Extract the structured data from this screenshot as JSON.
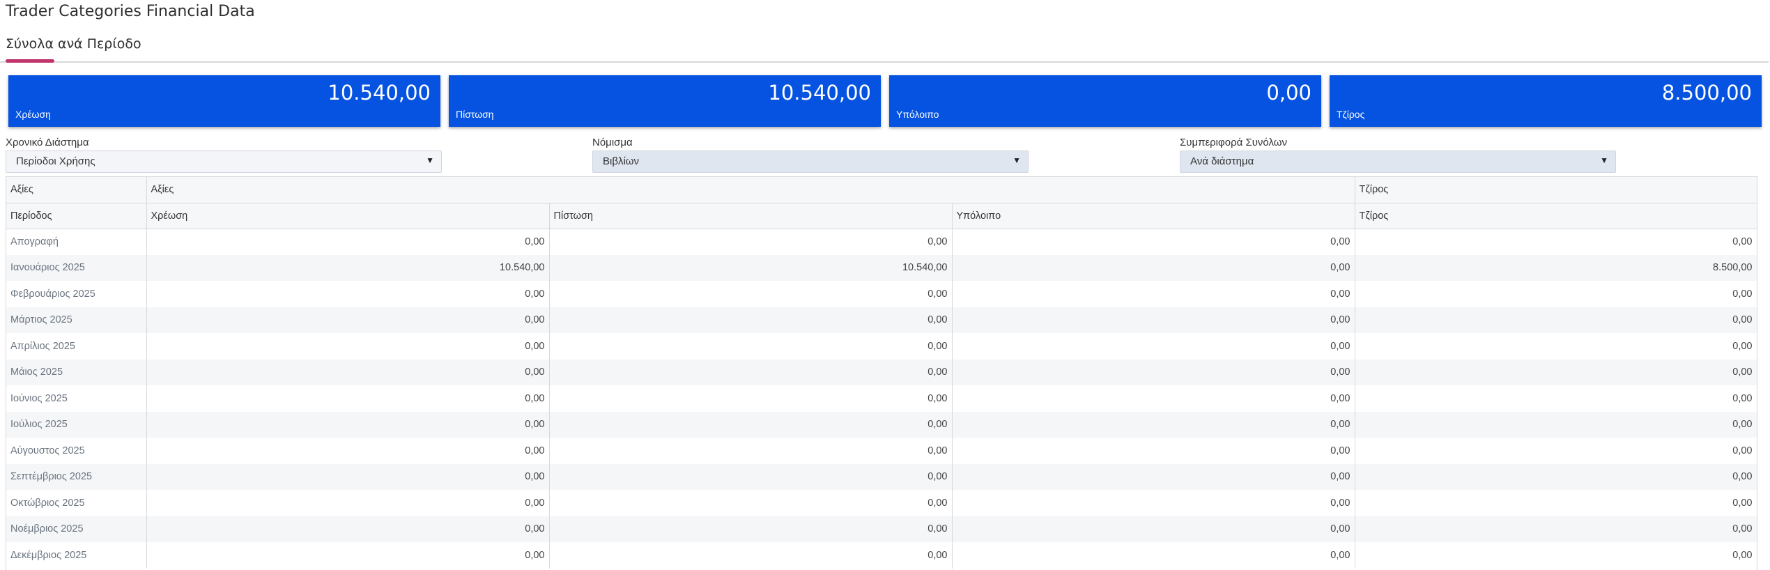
{
  "page": {
    "title": "Trader Categories Financial Data"
  },
  "tabs": [
    {
      "label": "Σύνολα ανά Περίοδο",
      "active": true
    }
  ],
  "colors": {
    "card_bg": "#0553e0",
    "accent": "#c0356b"
  },
  "cards": [
    {
      "value": "10.540,00",
      "label": "Χρέωση"
    },
    {
      "value": "10.540,00",
      "label": "Πίστωση"
    },
    {
      "value": "0,00",
      "label": "Υπόλοιπο"
    },
    {
      "value": "8.500,00",
      "label": "Τζίρος"
    }
  ],
  "filters": [
    {
      "label": "Χρονικό Διάστημα",
      "value": "Περίοδοι Χρήσης",
      "icon": "caret-down-icon"
    },
    {
      "label": "Νόμισμα",
      "value": "Βιβλίων",
      "icon": "caret-down-icon"
    },
    {
      "label": "Συμπεριφορά Συνόλων",
      "value": "Ανά διάστημα",
      "icon": "caret-down-icon"
    }
  ],
  "table": {
    "group_headers": [
      "Αξίες",
      "Αξίες",
      "Τζίρος"
    ],
    "headers": [
      "Περίοδος",
      "Χρέωση",
      "Πίστωση",
      "Υπόλοιπο",
      "Τζίρος"
    ],
    "rows": [
      [
        "Απογραφή",
        "0,00",
        "0,00",
        "0,00",
        "0,00"
      ],
      [
        "Ιανουάριος 2025",
        "10.540,00",
        "10.540,00",
        "0,00",
        "8.500,00"
      ],
      [
        "Φεβρουάριος 2025",
        "0,00",
        "0,00",
        "0,00",
        "0,00"
      ],
      [
        "Μάρτιος 2025",
        "0,00",
        "0,00",
        "0,00",
        "0,00"
      ],
      [
        "Απρίλιος 2025",
        "0,00",
        "0,00",
        "0,00",
        "0,00"
      ],
      [
        "Μάιος 2025",
        "0,00",
        "0,00",
        "0,00",
        "0,00"
      ],
      [
        "Ιούνιος 2025",
        "0,00",
        "0,00",
        "0,00",
        "0,00"
      ],
      [
        "Ιούλιος 2025",
        "0,00",
        "0,00",
        "0,00",
        "0,00"
      ],
      [
        "Αύγουστος 2025",
        "0,00",
        "0,00",
        "0,00",
        "0,00"
      ],
      [
        "Σεπτέμβριος 2025",
        "0,00",
        "0,00",
        "0,00",
        "0,00"
      ],
      [
        "Οκτώβριος 2025",
        "0,00",
        "0,00",
        "0,00",
        "0,00"
      ],
      [
        "Νοέμβριος 2025",
        "0,00",
        "0,00",
        "0,00",
        "0,00"
      ],
      [
        "Δεκέμβριος 2025",
        "0,00",
        "0,00",
        "0,00",
        "0,00"
      ]
    ]
  }
}
